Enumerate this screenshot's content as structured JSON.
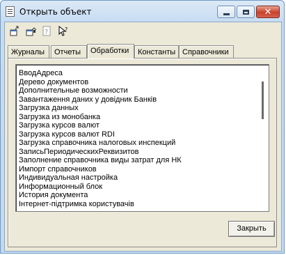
{
  "window": {
    "title": "Открыть объект"
  },
  "toolbar": {
    "buttons": [
      {
        "icon": "open-in-new-window-icon"
      },
      {
        "icon": "open-folder-icon"
      },
      {
        "icon": "help-icon"
      },
      {
        "icon": "whats-this-icon"
      }
    ]
  },
  "tabs": [
    {
      "label": "Журналы",
      "active": false
    },
    {
      "label": "Отчеты",
      "active": false
    },
    {
      "label": "Обработки",
      "active": true
    },
    {
      "label": "Константы",
      "active": false
    },
    {
      "label": "Справочники",
      "active": false
    }
  ],
  "list": {
    "items": [
      "ВводАдреса",
      "Дерево документов",
      "Дополнительные возможности",
      "Завантаження даних у довідник Банків",
      "Загрузка данных",
      "Загрузка из монобанка",
      "Загрузка курсов валют",
      "Загрузка курсов валют RDI",
      "Загрузка справочника налоговых инспекций",
      "ЗаписьПериодическихРеквизитов",
      "Заполнение справочника виды затрат для НК",
      "Импорт справочников",
      "Индивидуальная настройка",
      "Информационный блок",
      "История документа",
      "Інтернет-підтримка користувачів"
    ]
  },
  "footer": {
    "close_label": "Закрыть"
  },
  "colors": {
    "title_bar": "#c7dcf2",
    "dialog_face": "#ece9d8",
    "close_caption": "#c9412a"
  }
}
